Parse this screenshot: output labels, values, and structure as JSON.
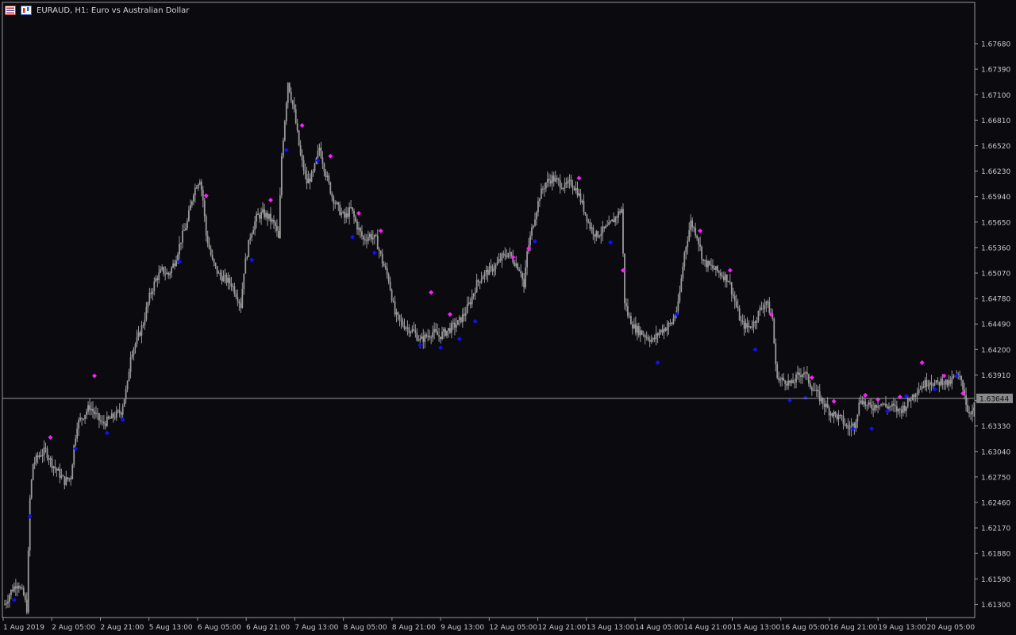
{
  "window": {
    "title": "EURAUD, H1:  Euro vs Australian Dollar"
  },
  "colors": {
    "background": "#0a0a0f",
    "candle": "#9a9a9a",
    "axis": "#9a9a9a",
    "text": "#c8c8c8",
    "up_fractal": "#ff1cff",
    "down_fractal": "#1010ff",
    "price_line": "#9a9a9a",
    "price_label_bg": "#8a8a8a"
  },
  "chart_data": {
    "type": "candlestick",
    "symbol": "EURAUD",
    "timeframe": "H1",
    "ylim": [
      1.6115,
      1.6815
    ],
    "y_ticks": [
      "1.67680",
      "1.67390",
      "1.67100",
      "1.66810",
      "1.66520",
      "1.66230",
      "1.65940",
      "1.65650",
      "1.65360",
      "1.65070",
      "1.64780",
      "1.64490",
      "1.64200",
      "1.63910",
      "1.63620",
      "1.63330",
      "1.63040",
      "1.62750",
      "1.62460",
      "1.62170",
      "1.61880",
      "1.61590",
      "1.61300"
    ],
    "x_labels": [
      "1 Aug 2019",
      "2 Aug 05:00",
      "2 Aug 21:00",
      "5 Aug 13:00",
      "6 Aug 05:00",
      "6 Aug 21:00",
      "7 Aug 13:00",
      "8 Aug 05:00",
      "8 Aug 21:00",
      "9 Aug 13:00",
      "12 Aug 05:00",
      "12 Aug 21:00",
      "13 Aug 13:00",
      "14 Aug 05:00",
      "14 Aug 21:00",
      "15 Aug 13:00",
      "16 Aug 05:00",
      "16 Aug 21:00",
      "19 Aug 13:00",
      "20 Aug 05:00"
    ],
    "current_price": 1.63644,
    "current_price_label": "1.63644",
    "close_path": [
      [
        0,
        1.613
      ],
      [
        4,
        1.6145
      ],
      [
        8,
        1.6155
      ],
      [
        12,
        1.614
      ],
      [
        14,
        1.6125
      ],
      [
        16,
        1.625
      ],
      [
        18,
        1.629
      ],
      [
        22,
        1.63
      ],
      [
        26,
        1.6305
      ],
      [
        30,
        1.629
      ],
      [
        34,
        1.628
      ],
      [
        38,
        1.627
      ],
      [
        42,
        1.6275
      ],
      [
        44,
        1.631
      ],
      [
        46,
        1.6335
      ],
      [
        50,
        1.6345
      ],
      [
        54,
        1.6355
      ],
      [
        58,
        1.6345
      ],
      [
        62,
        1.6335
      ],
      [
        66,
        1.634
      ],
      [
        70,
        1.6345
      ],
      [
        74,
        1.635
      ],
      [
        78,
        1.638
      ],
      [
        80,
        1.6415
      ],
      [
        84,
        1.643
      ],
      [
        88,
        1.645
      ],
      [
        92,
        1.648
      ],
      [
        96,
        1.65
      ],
      [
        100,
        1.651
      ],
      [
        104,
        1.6505
      ],
      [
        108,
        1.652
      ],
      [
        112,
        1.6545
      ],
      [
        116,
        1.6565
      ],
      [
        120,
        1.66
      ],
      [
        124,
        1.6615
      ],
      [
        126,
        1.659
      ],
      [
        128,
        1.655
      ],
      [
        132,
        1.652
      ],
      [
        136,
        1.6505
      ],
      [
        140,
        1.65
      ],
      [
        144,
        1.6495
      ],
      [
        148,
        1.648
      ],
      [
        150,
        1.647
      ],
      [
        152,
        1.651
      ],
      [
        156,
        1.655
      ],
      [
        160,
        1.657
      ],
      [
        164,
        1.6575
      ],
      [
        168,
        1.657
      ],
      [
        172,
        1.656
      ],
      [
        174,
        1.6545
      ],
      [
        176,
        1.664
      ],
      [
        180,
        1.6725
      ],
      [
        184,
        1.669
      ],
      [
        188,
        1.664
      ],
      [
        192,
        1.661
      ],
      [
        196,
        1.662
      ],
      [
        200,
        1.665
      ],
      [
        204,
        1.662
      ],
      [
        208,
        1.6595
      ],
      [
        212,
        1.658
      ],
      [
        216,
        1.657
      ],
      [
        220,
        1.658
      ],
      [
        224,
        1.656
      ],
      [
        228,
        1.6545
      ],
      [
        232,
        1.655
      ],
      [
        236,
        1.6545
      ],
      [
        240,
        1.652
      ],
      [
        244,
        1.65
      ],
      [
        248,
        1.646
      ],
      [
        252,
        1.645
      ],
      [
        256,
        1.6445
      ],
      [
        260,
        1.644
      ],
      [
        264,
        1.643
      ],
      [
        268,
        1.6435
      ],
      [
        272,
        1.644
      ],
      [
        276,
        1.6435
      ],
      [
        280,
        1.644
      ],
      [
        284,
        1.6445
      ],
      [
        288,
        1.645
      ],
      [
        292,
        1.646
      ],
      [
        296,
        1.6475
      ],
      [
        300,
        1.6495
      ],
      [
        304,
        1.6505
      ],
      [
        308,
        1.651
      ],
      [
        312,
        1.6515
      ],
      [
        316,
        1.6525
      ],
      [
        320,
        1.653
      ],
      [
        324,
        1.652
      ],
      [
        328,
        1.651
      ],
      [
        330,
        1.649
      ],
      [
        332,
        1.653
      ],
      [
        336,
        1.6565
      ],
      [
        340,
        1.6595
      ],
      [
        344,
        1.661
      ],
      [
        348,
        1.6615
      ],
      [
        352,
        1.661
      ],
      [
        356,
        1.6605
      ],
      [
        360,
        1.661
      ],
      [
        364,
        1.66
      ],
      [
        368,
        1.658
      ],
      [
        372,
        1.656
      ],
      [
        376,
        1.655
      ],
      [
        380,
        1.6555
      ],
      [
        384,
        1.656
      ],
      [
        388,
        1.657
      ],
      [
        392,
        1.658
      ],
      [
        394,
        1.6475
      ],
      [
        396,
        1.646
      ],
      [
        400,
        1.6445
      ],
      [
        404,
        1.644
      ],
      [
        408,
        1.6435
      ],
      [
        412,
        1.643
      ],
      [
        416,
        1.644
      ],
      [
        420,
        1.6445
      ],
      [
        424,
        1.645
      ],
      [
        428,
        1.647
      ],
      [
        432,
        1.653
      ],
      [
        436,
        1.6565
      ],
      [
        440,
        1.655
      ],
      [
        444,
        1.652
      ],
      [
        448,
        1.6515
      ],
      [
        452,
        1.651
      ],
      [
        456,
        1.6505
      ],
      [
        460,
        1.65
      ],
      [
        464,
        1.6475
      ],
      [
        468,
        1.645
      ],
      [
        472,
        1.6445
      ],
      [
        476,
        1.645
      ],
      [
        480,
        1.6465
      ],
      [
        484,
        1.6475
      ],
      [
        488,
        1.6455
      ],
      [
        490,
        1.64
      ],
      [
        492,
        1.6385
      ],
      [
        496,
        1.6385
      ],
      [
        500,
        1.638
      ],
      [
        504,
        1.639
      ],
      [
        508,
        1.6395
      ],
      [
        512,
        1.638
      ],
      [
        516,
        1.637
      ],
      [
        520,
        1.636
      ],
      [
        524,
        1.635
      ],
      [
        528,
        1.6345
      ],
      [
        532,
        1.634
      ],
      [
        536,
        1.633
      ],
      [
        540,
        1.6335
      ],
      [
        544,
        1.6365
      ],
      [
        548,
        1.6355
      ],
      [
        552,
        1.6355
      ],
      [
        556,
        1.636
      ],
      [
        560,
        1.6355
      ],
      [
        564,
        1.6355
      ],
      [
        568,
        1.635
      ],
      [
        572,
        1.6355
      ],
      [
        576,
        1.6365
      ],
      [
        580,
        1.6375
      ],
      [
        584,
        1.638
      ],
      [
        588,
        1.6385
      ],
      [
        592,
        1.638
      ],
      [
        596,
        1.6385
      ],
      [
        600,
        1.638
      ],
      [
        604,
        1.639
      ],
      [
        608,
        1.6385
      ],
      [
        610,
        1.637
      ],
      [
        612,
        1.635
      ]
    ],
    "fractals_up": [
      [
        29,
        1.632
      ],
      [
        57,
        1.639
      ],
      [
        128,
        1.6595
      ],
      [
        169,
        1.659
      ],
      [
        189,
        1.6675
      ],
      [
        207,
        1.664
      ],
      [
        225,
        1.6575
      ],
      [
        239,
        1.6555
      ],
      [
        271,
        1.6485
      ],
      [
        283,
        1.646
      ],
      [
        323,
        1.6525
      ],
      [
        333,
        1.6535
      ],
      [
        365,
        1.6615
      ],
      [
        393,
        1.651
      ],
      [
        442,
        1.6555
      ],
      [
        461,
        1.651
      ],
      [
        487,
        1.646
      ],
      [
        513,
        1.6388
      ],
      [
        527,
        1.6361
      ],
      [
        547,
        1.6368
      ],
      [
        555,
        1.6363
      ],
      [
        569,
        1.6366
      ],
      [
        583,
        1.6405
      ],
      [
        597,
        1.639
      ],
      [
        609,
        1.637
      ]
    ],
    "fractals_down": [
      [
        6,
        1.6135
      ],
      [
        16,
        1.623
      ],
      [
        45,
        1.6307
      ],
      [
        65,
        1.6325
      ],
      [
        75,
        1.634
      ],
      [
        111,
        1.652
      ],
      [
        157,
        1.6522
      ],
      [
        179,
        1.6647
      ],
      [
        199,
        1.6635
      ],
      [
        221,
        1.6548
      ],
      [
        235,
        1.653
      ],
      [
        264,
        1.6425
      ],
      [
        277,
        1.6422
      ],
      [
        289,
        1.6432
      ],
      [
        299,
        1.6452
      ],
      [
        337,
        1.6543
      ],
      [
        385,
        1.6542
      ],
      [
        415,
        1.6405
      ],
      [
        427,
        1.646
      ],
      [
        477,
        1.642
      ],
      [
        499,
        1.6362
      ],
      [
        509,
        1.6365
      ],
      [
        539,
        1.633
      ],
      [
        551,
        1.633
      ],
      [
        561,
        1.635
      ],
      [
        573,
        1.6367
      ],
      [
        591,
        1.6375
      ],
      [
        605,
        1.639
      ]
    ]
  }
}
